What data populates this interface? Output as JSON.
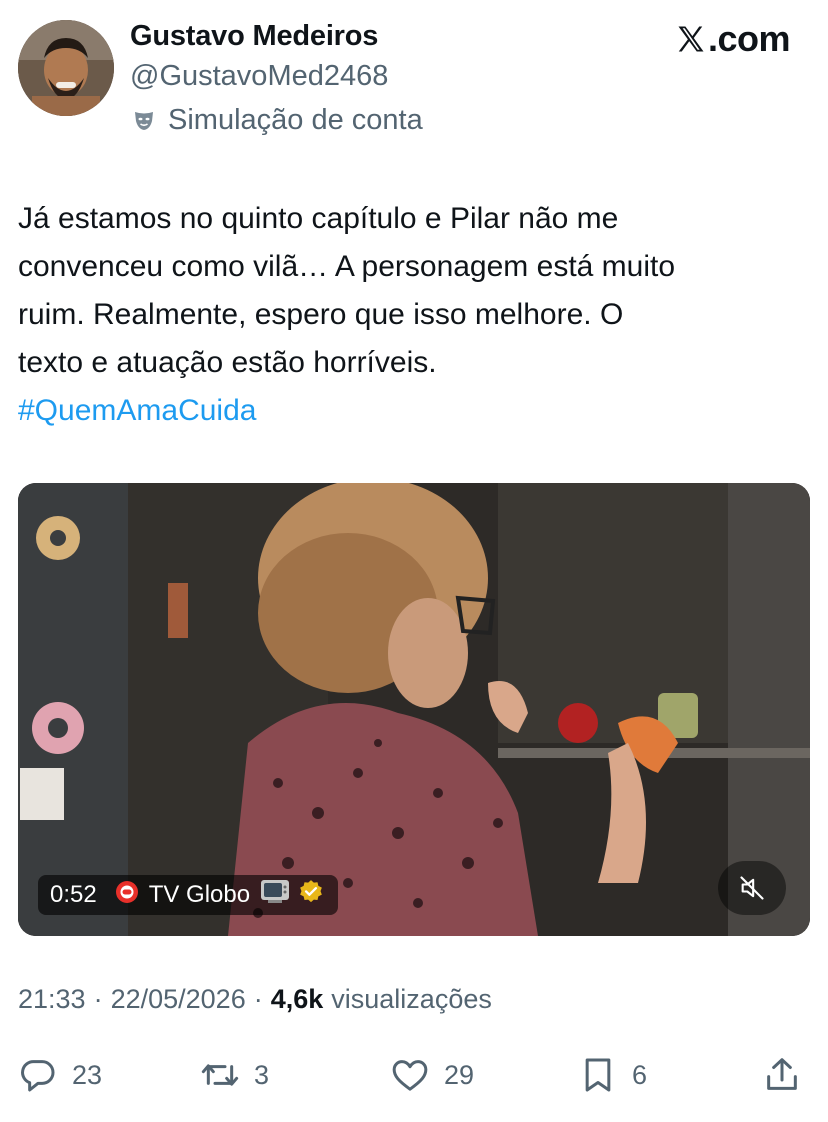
{
  "author": {
    "name": "Gustavo Medeiros",
    "handle": "@GustavoMed2468",
    "label": "Simulação de conta"
  },
  "brand": {
    "logo_text": ".com"
  },
  "tweet": {
    "text": "Já estamos no quinto capítulo e Pilar não me\nconvenceu como vilã… A personagem está muito\nruim. Realmente, espero que isso melhore. O\ntexto e atuação estão horríveis.",
    "hashtag": "#QuemAmaCuida"
  },
  "media": {
    "duration": "0:52",
    "source": "TV Globo"
  },
  "meta": {
    "time": "21:33",
    "date": "22/05/2026",
    "views_count": "4,6k",
    "views_label": "visualizações",
    "separator": "·"
  },
  "actions": {
    "replies": "23",
    "reposts": "3",
    "likes": "29",
    "bookmarks": "6"
  },
  "colors": {
    "link": "#1d9bf0",
    "secondary_text": "#536471",
    "primary_text": "#0f1419",
    "verified": "#e8b71a"
  },
  "icons": [
    "mask-icon",
    "x-logo-icon",
    "globo-icon",
    "tv-icon",
    "verified-icon",
    "mute-icon",
    "reply-icon",
    "repost-icon",
    "like-icon",
    "bookmark-icon",
    "share-icon"
  ]
}
